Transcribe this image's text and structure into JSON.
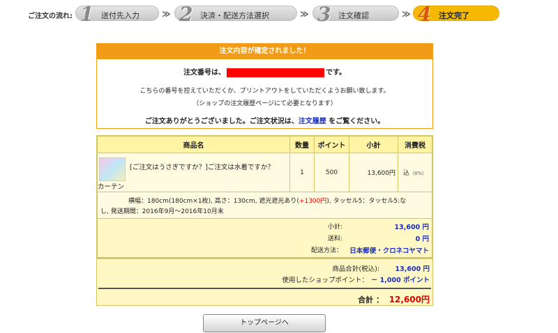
{
  "steps": {
    "label": "ご注文の流れ:",
    "items": [
      {
        "num": "1",
        "label": "送付先入力"
      },
      {
        "num": "2",
        "label": "決済・配送方法選択"
      },
      {
        "num": "3",
        "label": "注文確認"
      },
      {
        "num": "4",
        "label": "注文完了"
      }
    ],
    "separator": "≫"
  },
  "confirm": {
    "header": "注文内容が確定されました！",
    "order_prefix": "注文番号は、",
    "order_suffix": "です。",
    "note1": "こちらの番号を控えていただくか、プリントアウトをしていただくようお願い致します。",
    "note2": "（ショップの注文履歴ページにて必要となります）",
    "thanks_prefix": "ご注文ありがとうございました。ご注文状況は、",
    "thanks_link": "注文履歴",
    "thanks_suffix": " をご覧ください。"
  },
  "table": {
    "headers": [
      "商品名",
      "数量",
      "ポイント",
      "小計",
      "消費税"
    ],
    "product": {
      "name_line1": "[ご注文はうさぎですか？]ご注文は水着ですか？",
      "name_line2": "カーテン",
      "qty": "1",
      "points": "500",
      "subtotal": "13,600円",
      "tax": "込",
      "tax_rate": "（8%）"
    },
    "options": {
      "line1_a": "横幅：180cm(180cm×1枚), 高さ：130cm, 遮光遮光あり(",
      "line1_plus": "+1300円",
      "line1_b": "), タッセル5：タッセル5:な",
      "line2": "し, 発送期間：2016年9月～2016年10月末"
    },
    "subtotals": {
      "subtotal_label": "小計:",
      "subtotal_value": "13,600 円",
      "shipping_label": "送料:",
      "shipping_value": "0 円",
      "method_label": "配送方法：",
      "method_value": "日本郵便・クロネコヤマト"
    }
  },
  "totals": {
    "items_label": "商品合計(税込):",
    "items_value": "13,600 円",
    "points_label": "使用したショップポイント：",
    "points_value": "－ 1,000 ポイント",
    "grand_label": "合計 ：",
    "grand_value": "12,600円"
  },
  "button": {
    "top_label": "トップページへ"
  }
}
